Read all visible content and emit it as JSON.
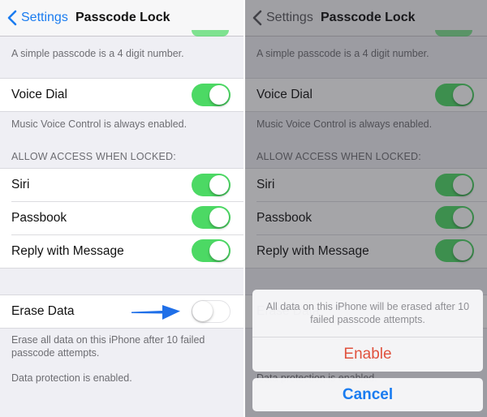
{
  "colors": {
    "accent": "#1a7cf0",
    "switch_on": "#4cd964",
    "destructive": "#e0523e",
    "arrow": "#1f6fe8"
  },
  "navbar": {
    "back_label": "Settings",
    "back_icon": "chevron-left-icon",
    "title": "Passcode Lock"
  },
  "settings": {
    "simple_passcode_footer": "A simple passcode is a 4 digit number.",
    "voice_dial": {
      "label": "Voice Dial",
      "on": true
    },
    "voice_dial_footer": "Music Voice Control is always enabled.",
    "allow_access_header": "ALLOW ACCESS WHEN LOCKED:",
    "allow_access_items": [
      {
        "label": "Siri",
        "on": true
      },
      {
        "label": "Passbook",
        "on": true
      },
      {
        "label": "Reply with Message",
        "on": true
      }
    ],
    "erase_data": {
      "label": "Erase Data",
      "on": false
    },
    "erase_footer": "Erase all data on this iPhone after 10 failed passcode attempts.",
    "data_protection_footer": "Data protection is enabled."
  },
  "action_sheet": {
    "message": "All data on this iPhone will be erased after 10 failed passcode attempts.",
    "enable_label": "Enable",
    "cancel_label": "Cancel"
  },
  "annotation": {
    "icon": "arrow-right-icon",
    "points_to": "Erase Data switch"
  }
}
